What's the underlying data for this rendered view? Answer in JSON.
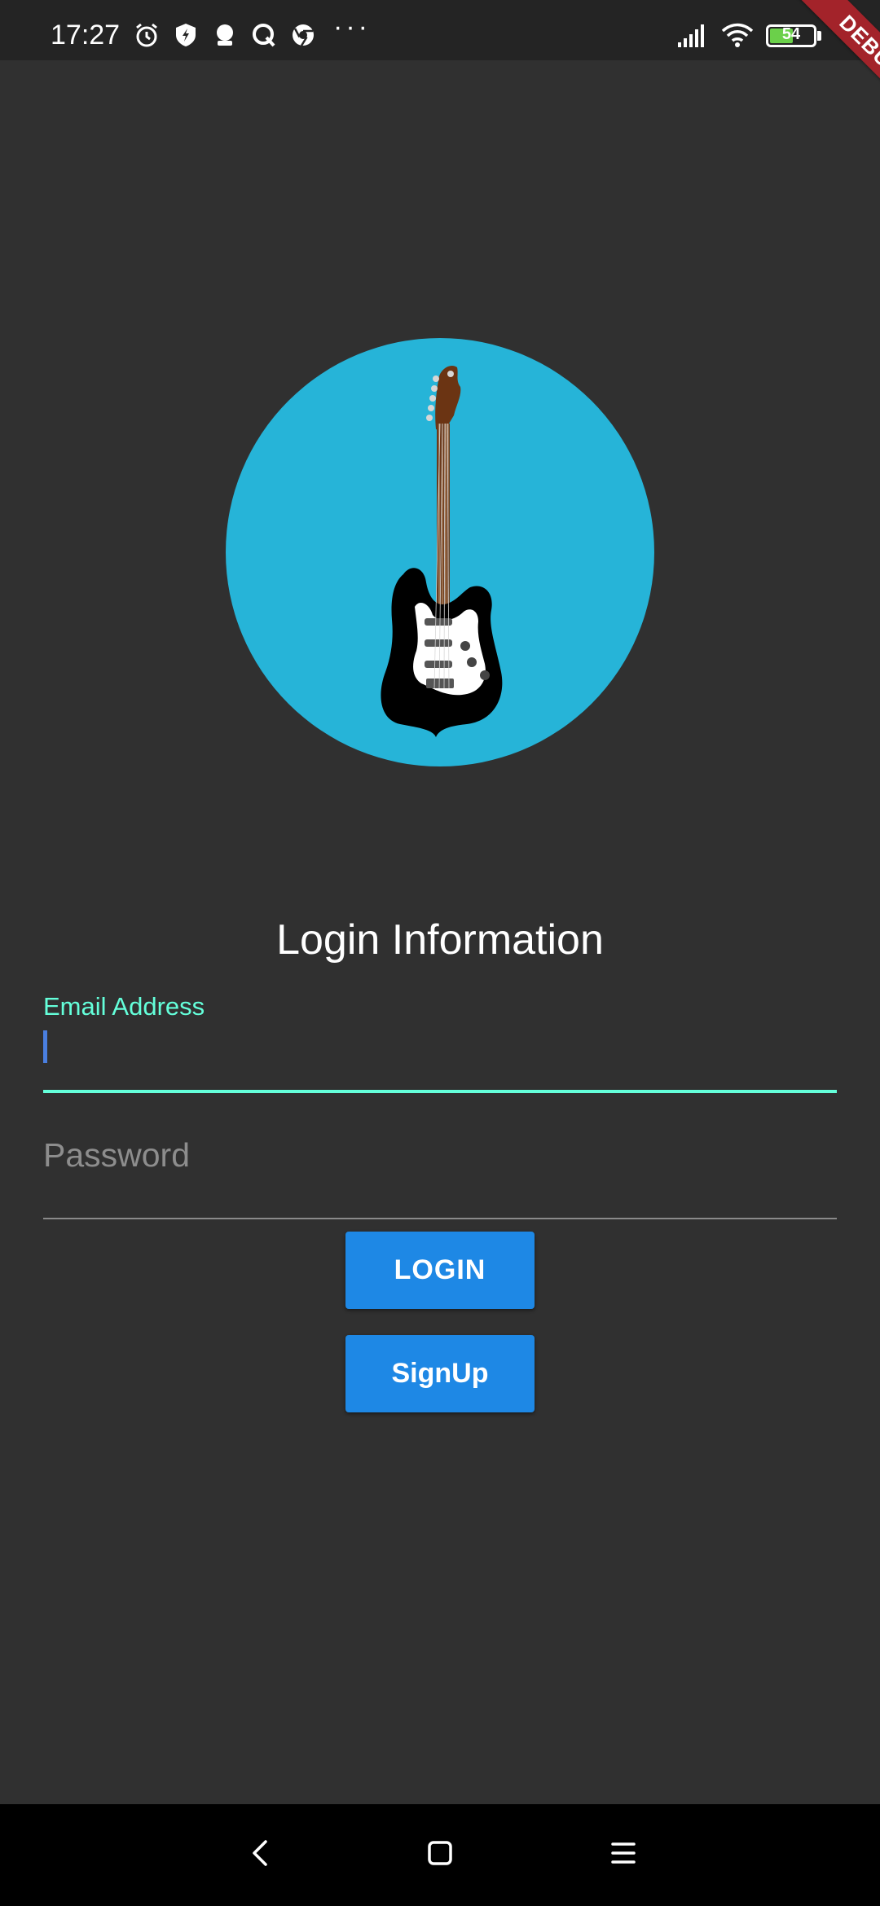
{
  "status_bar": {
    "time": "17:27",
    "icons": [
      "alarm-icon",
      "shield-bolt-icon",
      "robot-icon",
      "q-icon",
      "chrome-icon",
      "more-dots-icon",
      "signal-icon",
      "wifi-icon",
      "battery-icon"
    ],
    "more_dots": "···",
    "battery_level": "54",
    "battery_fraction": 0.54
  },
  "debug_banner": "DEBUG",
  "logo": {
    "icon": "guitar-icon",
    "background_color": "#26b4d8"
  },
  "form": {
    "title": "Login Information",
    "email_label": "Email Address",
    "email_value": "",
    "password_placeholder": "Password",
    "accent_color": "#64ffda"
  },
  "buttons": {
    "login_label": "LOGIN",
    "signup_label": "SignUp",
    "color": "#1e88e5"
  },
  "nav_bar": {
    "icons": [
      "back-icon",
      "home-icon",
      "menu-icon"
    ]
  }
}
